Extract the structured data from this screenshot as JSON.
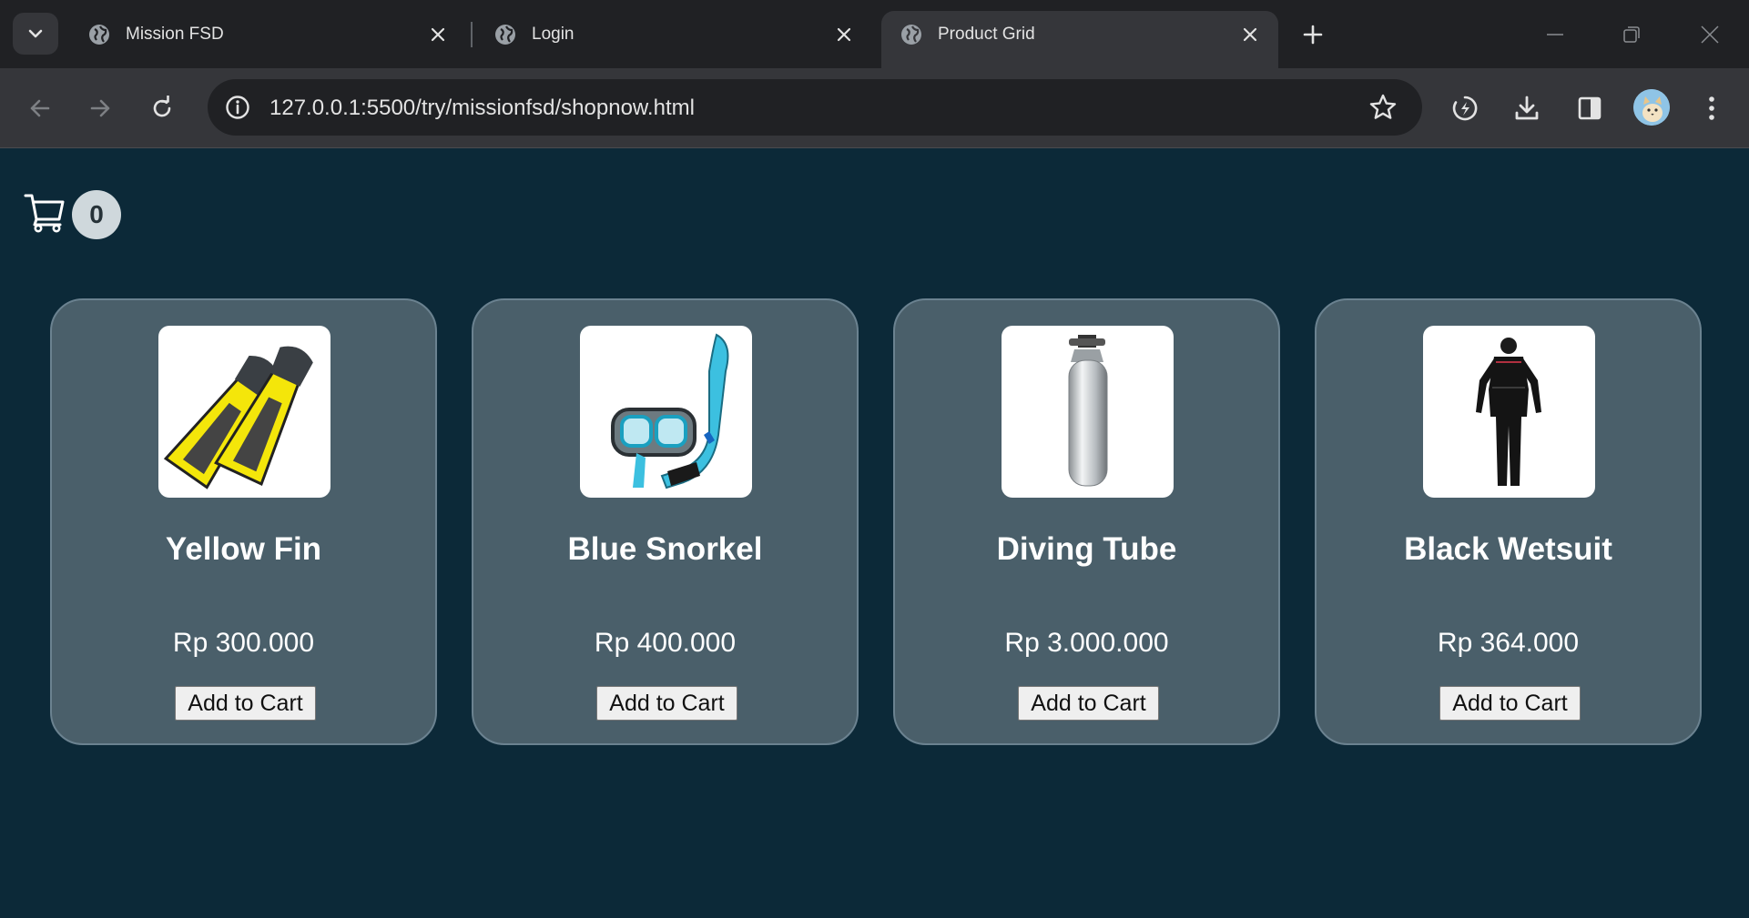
{
  "browser": {
    "tabs": [
      {
        "title": "Mission FSD",
        "active": false
      },
      {
        "title": "Login",
        "active": false
      },
      {
        "title": "Product Grid",
        "active": true
      }
    ],
    "url": "127.0.0.1:5500/try/missionfsd/shopnow.html"
  },
  "cart": {
    "count": "0"
  },
  "products": [
    {
      "name": "Yellow Fin",
      "price": "Rp 300.000",
      "button": "Add to Cart"
    },
    {
      "name": "Blue Snorkel",
      "price": "Rp 400.000",
      "button": "Add to Cart"
    },
    {
      "name": "Diving Tube",
      "price": "Rp 3.000.000",
      "button": "Add to Cart"
    },
    {
      "name": "Black Wetsuit",
      "price": "Rp 364.000",
      "button": "Add to Cart"
    }
  ],
  "colors": {
    "page_bg": "#0c2938",
    "card_bg": "#4a5f6a"
  }
}
